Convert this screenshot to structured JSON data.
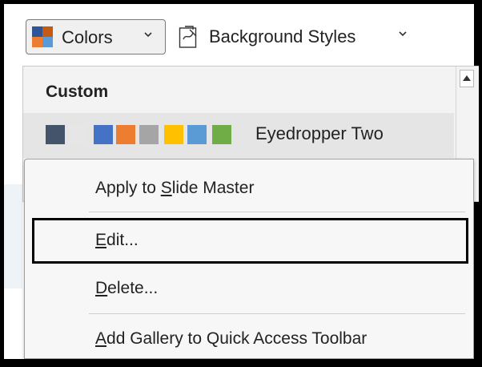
{
  "toolbar": {
    "colors_label": "Colors",
    "background_styles_label": "Background Styles"
  },
  "gallery": {
    "section_header": "Custom",
    "items": [
      {
        "label": "Eyedropper Two",
        "swatches": [
          "#44546a",
          "#e7e6e6",
          "#4472c4",
          "#ed7d31",
          "#a5a5a5",
          "#ffc000",
          "#5b9bd5",
          "#70ad47"
        ]
      }
    ]
  },
  "menu": {
    "items": [
      {
        "label": "Apply to Slide Master",
        "before": "Apply to ",
        "access": "S",
        "after": "lide Master"
      },
      {
        "label": "Edit...",
        "before": "",
        "access": "E",
        "after": "dit..."
      },
      {
        "label": "Delete...",
        "before": "",
        "access": "D",
        "after": "elete..."
      },
      {
        "label": "Add Gallery to Quick Access Toolbar",
        "before": "",
        "access": "A",
        "after": "dd Gallery to Quick Access Toolbar"
      }
    ],
    "focused_item": "Edit..."
  },
  "colors": {
    "palette_icon": [
      "#2f5597",
      "#ed7d31",
      "#2f5597",
      "#ed7d31"
    ]
  }
}
